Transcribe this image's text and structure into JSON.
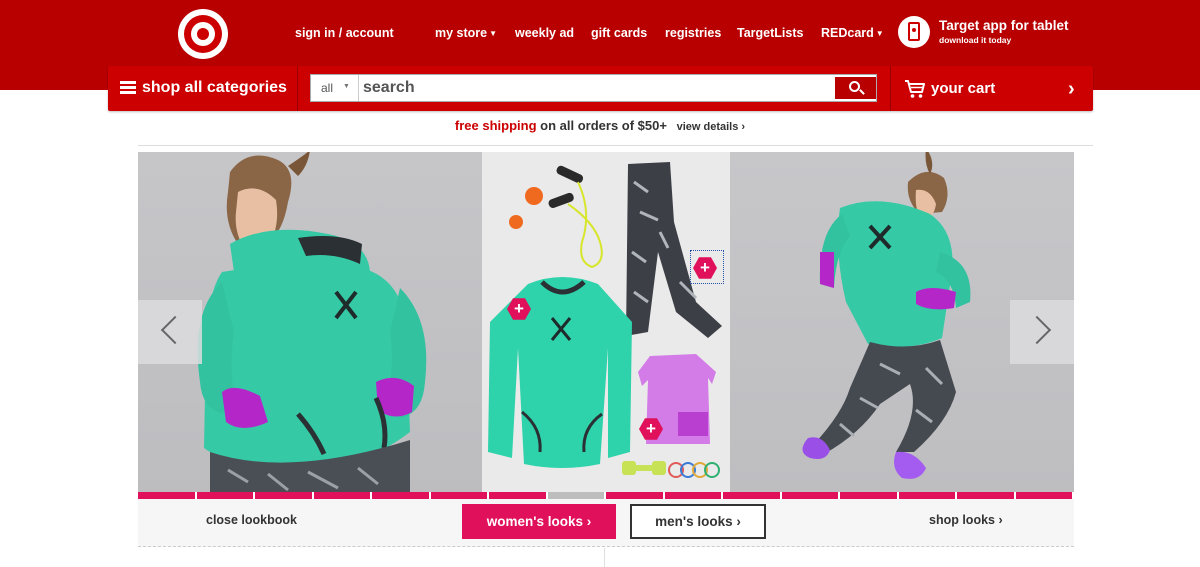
{
  "header": {
    "logo": "target-bullseye-logo",
    "nav": [
      {
        "label": "sign in / account",
        "has_caret": false
      },
      {
        "label": "my store",
        "has_caret": true
      },
      {
        "label": "weekly ad",
        "has_caret": false
      },
      {
        "label": "gift cards",
        "has_caret": false
      },
      {
        "label": "registries",
        "has_caret": false
      },
      {
        "label": "TargetLists",
        "has_caret": false
      },
      {
        "label": "REDcard",
        "has_caret": true
      }
    ],
    "app_promo": {
      "title": "Target app for tablet",
      "subtitle": "download it today",
      "icon": "tablet-icon"
    }
  },
  "search_bar": {
    "shop_all_label": "shop all categories",
    "scope": "all",
    "placeholder": "search",
    "value": "",
    "search_icon": "magnifier-icon",
    "cart_label": "your cart",
    "cart_icon": "shopping-cart-icon"
  },
  "promo": {
    "highlight": "free shipping",
    "text": "on all orders of $50+",
    "link": "view details ›"
  },
  "lookbook": {
    "prev_icon": "chevron-left-icon",
    "next_icon": "chevron-right-icon",
    "slide_count": 16,
    "active_slide": 8,
    "hotspot_icon": "plus-hexagon-icon",
    "close_label": "close lookbook",
    "women_label": "women's looks ›",
    "men_label": "men's looks ›",
    "shop_label": "shop looks ›"
  },
  "colors": {
    "brand_red": "#cc0000",
    "header_red": "#b80000",
    "accent_pink": "#e0105a",
    "hoodie_teal": "#35c9a5",
    "glove_magenta": "#b526c9"
  }
}
